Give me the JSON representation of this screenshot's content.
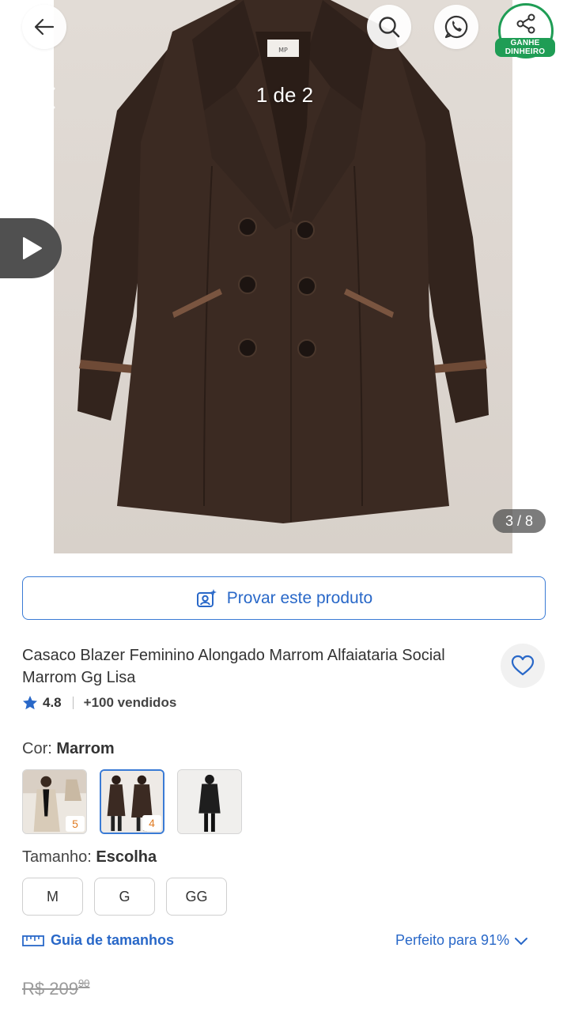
{
  "gallery": {
    "image_counter": "1 de 2",
    "pager": "3 / 8",
    "earn_badge_line1": "GANHE",
    "earn_badge_line2": "DINHEIRO"
  },
  "try_on": {
    "label": "Provar este produto"
  },
  "product": {
    "title": "Casaco Blazer Feminino Alongado Marrom Alfaiataria Social Marrom Gg Lisa",
    "rating": "4.8",
    "sold": "+100 vendidos"
  },
  "color": {
    "label": "Cor:",
    "selected": "Marrom",
    "swatches": [
      {
        "name": "bege",
        "count": "5"
      },
      {
        "name": "marrom",
        "count": "4"
      },
      {
        "name": "preto",
        "count": ""
      }
    ]
  },
  "size": {
    "label": "Tamanho:",
    "selected": "Escolha",
    "options": [
      "M",
      "G",
      "GG"
    ]
  },
  "size_guide": {
    "label": "Guia de tamanhos"
  },
  "fit": {
    "label": "Perfeito para 91%"
  },
  "price": {
    "old_main": "R$ 209",
    "old_cents": "90"
  },
  "colors": {
    "accent_blue": "#2968c8",
    "earn_green": "#1f9d55",
    "coat_brown": "#3b2a22",
    "star": "#2968c8"
  },
  "icons": [
    "back-arrow-icon",
    "search-icon",
    "whatsapp-icon",
    "share-icon",
    "close-icon",
    "play-icon",
    "camera-sparkle-icon",
    "heart-icon",
    "star-icon",
    "ruler-icon",
    "chevron-down-icon"
  ]
}
